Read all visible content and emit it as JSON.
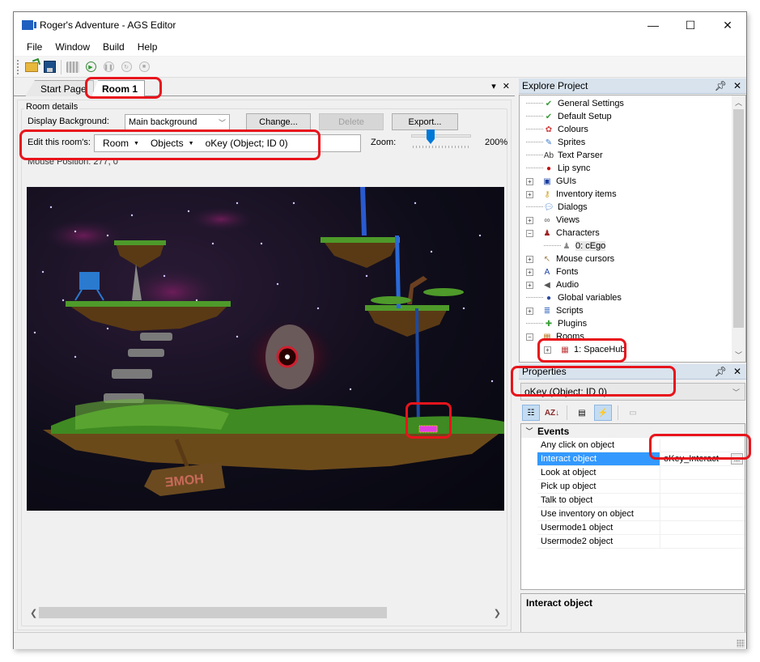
{
  "window": {
    "title": "Roger's Adventure - AGS Editor",
    "controls": {
      "minimize": "—",
      "maximize": "☐",
      "close": "✕"
    }
  },
  "menu": [
    "File",
    "Window",
    "Build",
    "Help"
  ],
  "toolbar": {
    "icons": [
      "open-folder-icon",
      "save-icon",
      "build-icon",
      "run-icon",
      "pause-icon",
      "step-icon",
      "stop-icon"
    ]
  },
  "doc_tabs": {
    "tabs": [
      {
        "label": "Start Page",
        "active": false
      },
      {
        "label": "Room 1",
        "active": true
      }
    ],
    "dropdown_glyph": "▾",
    "close_glyph": "✕"
  },
  "room_editor": {
    "group_title": "Room details",
    "display_background_label": "Display Background:",
    "display_background_value": "Main background",
    "buttons": {
      "change": "Change...",
      "delete": "Delete",
      "export": "Export..."
    },
    "edit_label": "Edit this room's:",
    "breadcrumb": [
      {
        "label": "Room",
        "has_dropdown": true
      },
      {
        "label": "Objects",
        "has_dropdown": true
      },
      {
        "label": "oKey (Object; ID 0)",
        "has_dropdown": false
      }
    ],
    "zoom_label": "Zoom:",
    "zoom_value": "200%",
    "mouse_position": "Mouse Position: 277, 0",
    "sign_text": "HOME"
  },
  "explore_project": {
    "title": "Explore Project",
    "items": [
      {
        "label": "General Settings",
        "icon": "checkmark-icon",
        "depth": 0,
        "expander": ""
      },
      {
        "label": "Default Setup",
        "icon": "checkmark-icon",
        "depth": 0,
        "expander": ""
      },
      {
        "label": "Colours",
        "icon": "palette-icon",
        "depth": 0,
        "expander": ""
      },
      {
        "label": "Sprites",
        "icon": "sprite-icon",
        "depth": 0,
        "expander": ""
      },
      {
        "label": "Text Parser",
        "icon": "text-parser-icon",
        "depth": 0,
        "expander": ""
      },
      {
        "label": "Lip sync",
        "icon": "lips-icon",
        "depth": 0,
        "expander": ""
      },
      {
        "label": "GUIs",
        "icon": "gui-icon",
        "depth": 0,
        "expander": "+"
      },
      {
        "label": "Inventory items",
        "icon": "key-icon",
        "depth": 0,
        "expander": "+"
      },
      {
        "label": "Dialogs",
        "icon": "speech-bubble-icon",
        "depth": 0,
        "expander": ""
      },
      {
        "label": "Views",
        "icon": "glasses-icon",
        "depth": 0,
        "expander": "+"
      },
      {
        "label": "Characters",
        "icon": "characters-icon",
        "depth": 0,
        "expander": "−"
      },
      {
        "label": "0: cEgo",
        "icon": "character-icon",
        "depth": 1,
        "expander": ""
      },
      {
        "label": "Mouse cursors",
        "icon": "cursor-icon",
        "depth": 0,
        "expander": "+"
      },
      {
        "label": "Fonts",
        "icon": "font-icon",
        "depth": 0,
        "expander": "+"
      },
      {
        "label": "Audio",
        "icon": "speaker-icon",
        "depth": 0,
        "expander": "+"
      },
      {
        "label": "Global variables",
        "icon": "globe-icon",
        "depth": 0,
        "expander": ""
      },
      {
        "label": "Scripts",
        "icon": "scroll-icon",
        "depth": 0,
        "expander": "+"
      },
      {
        "label": "Plugins",
        "icon": "puzzle-icon",
        "depth": 0,
        "expander": ""
      },
      {
        "label": "Rooms",
        "icon": "rooms-icon",
        "depth": 0,
        "expander": "−"
      },
      {
        "label": "1: SpaceHub",
        "icon": "room-icon",
        "depth": 1,
        "expander": "+"
      }
    ]
  },
  "properties": {
    "title": "Properties",
    "selected_object": "oKey (Object; ID 0)",
    "category": "Events",
    "rows": [
      {
        "name": "Any click on object",
        "value": ""
      },
      {
        "name": "Interact object",
        "value": "oKey_Interact",
        "selected": true
      },
      {
        "name": "Look at object",
        "value": ""
      },
      {
        "name": "Pick up object",
        "value": ""
      },
      {
        "name": "Talk to object",
        "value": ""
      },
      {
        "name": "Use inventory on object",
        "value": ""
      },
      {
        "name": "Usermode1 object",
        "value": ""
      },
      {
        "name": "Usermode2 object",
        "value": ""
      }
    ],
    "ellipsis": "...",
    "description_title": "Interact object"
  },
  "colors": {
    "highlight": "#e8141c",
    "selection": "#3399ff",
    "pane_header": "#d8e3ee"
  }
}
